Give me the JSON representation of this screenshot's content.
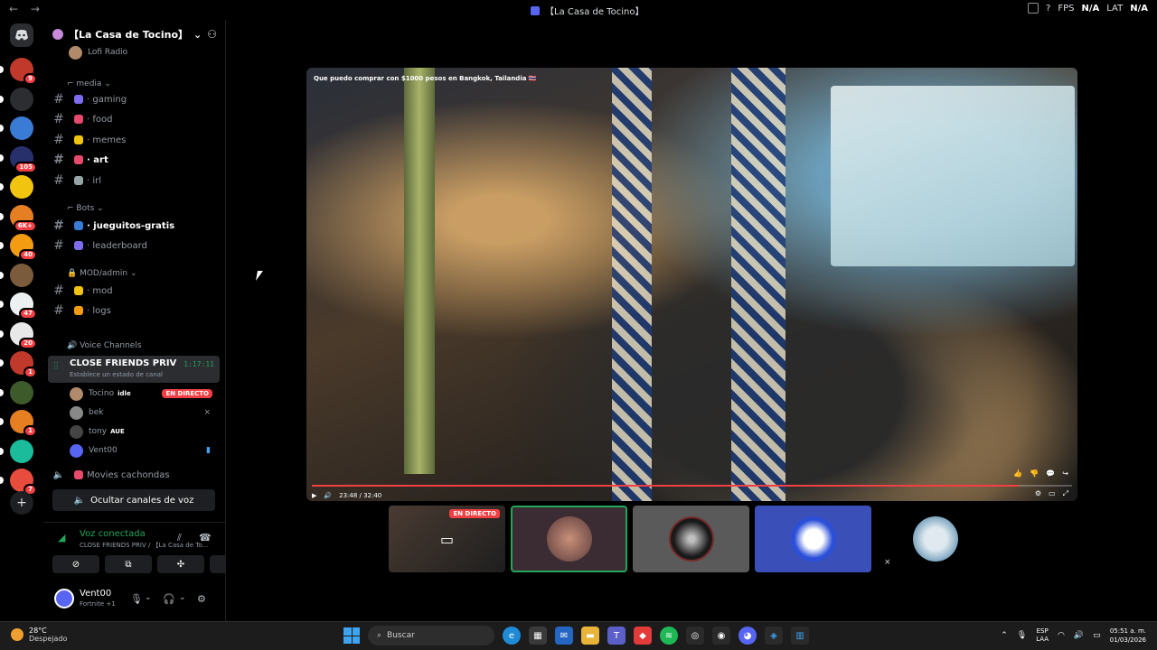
{
  "window": {
    "title": "【La Casa de Tocino】",
    "fps_label": "FPS",
    "fps_value": "N/A",
    "lat_label": "LAT",
    "lat_value": "N/A"
  },
  "guilds": [
    {
      "badge": "9",
      "color": "#c0392b"
    },
    {
      "badge": "",
      "color": "#2b2d31"
    },
    {
      "badge": "",
      "color": "#3a7bd5"
    },
    {
      "badge": "105",
      "color": "#27306b"
    },
    {
      "badge": "",
      "color": "#f1c40f"
    },
    {
      "badge": "6K+",
      "color": "#e67e22"
    },
    {
      "badge": "40",
      "color": "#f39c12"
    },
    {
      "badge": "",
      "color": "#7a5c3d"
    },
    {
      "badge": "47",
      "color": "#ecf0f1"
    },
    {
      "badge": "20",
      "color": "#e8e8e8"
    },
    {
      "badge": "1",
      "color": "#c0392b"
    },
    {
      "badge": "",
      "color": "#3d5a2a"
    },
    {
      "badge": "1",
      "color": "#e67e22"
    },
    {
      "badge": "",
      "color": "#1abc9c"
    },
    {
      "badge": "7",
      "color": "#e74c3c"
    }
  ],
  "server": {
    "name": "【La Casa de Tocino】",
    "top_item": "Lofi Radio",
    "categories": {
      "media": "media",
      "bots": "Bots",
      "mod": "MOD/admin",
      "voice": "Voice Channels"
    },
    "channels": [
      {
        "name": "gaming",
        "prefix": "·",
        "bold": false,
        "color": "#7b6cf0"
      },
      {
        "name": "food",
        "prefix": "·",
        "bold": false,
        "color": "#e84a6e"
      },
      {
        "name": "memes",
        "prefix": "·",
        "bold": false,
        "color": "#f1c40f"
      },
      {
        "name": "art",
        "prefix": "·",
        "bold": true,
        "color": "#e84a6e"
      },
      {
        "name": "irl",
        "prefix": "·",
        "bold": false,
        "color": "#95a5a6"
      },
      {
        "name": "jueguitos-gratis",
        "prefix": "·",
        "bold": true,
        "color": "#3a7bd5"
      },
      {
        "name": "leaderboard",
        "prefix": "·",
        "bold": false,
        "color": "#7b6cf0"
      },
      {
        "name": "mod",
        "prefix": "·",
        "bold": false,
        "color": "#f1c40f"
      },
      {
        "name": "logs",
        "prefix": "·",
        "bold": false,
        "color": "#f39c12"
      }
    ],
    "voice_channel": {
      "name": "CLOSE FRIENDS PRIV",
      "status": "Establece un estado de canal",
      "time": "1:17:11"
    },
    "voice_users": [
      {
        "name": "Tocino",
        "badge": "idle",
        "live": "EN DIRECTO",
        "color": "#b08a6a"
      },
      {
        "name": "bek",
        "badge": "",
        "live": "",
        "color": "#888"
      },
      {
        "name": "tony",
        "badge": "AUE",
        "live": "",
        "color": "#444"
      },
      {
        "name": "Vent00",
        "badge": "",
        "live": "",
        "color": "#5865f2"
      }
    ],
    "other_voice": "Movies cachondas",
    "hide_voice_label": "Ocultar canales de voz"
  },
  "voice_panel": {
    "status": "Voz conectada",
    "location": "CLOSE FRIENDS PRIV / 【La Casa de To..."
  },
  "user": {
    "name": "Vent00",
    "activity": "Fortnite +1"
  },
  "stream": {
    "video_title": "Que puedo comprar con $1000 pesos en Bangkok, Tailandia 🇹🇭",
    "time": "23:48 / 32:40",
    "progress": 0.93,
    "live_badge": "EN DIRECTO"
  },
  "taskbar": {
    "temp": "28°C",
    "weather": "Despejado",
    "search": "Buscar",
    "lang1": "ESP",
    "lang2": "LAA",
    "time": "05:51 a. m.",
    "date": "01/03/2026"
  }
}
